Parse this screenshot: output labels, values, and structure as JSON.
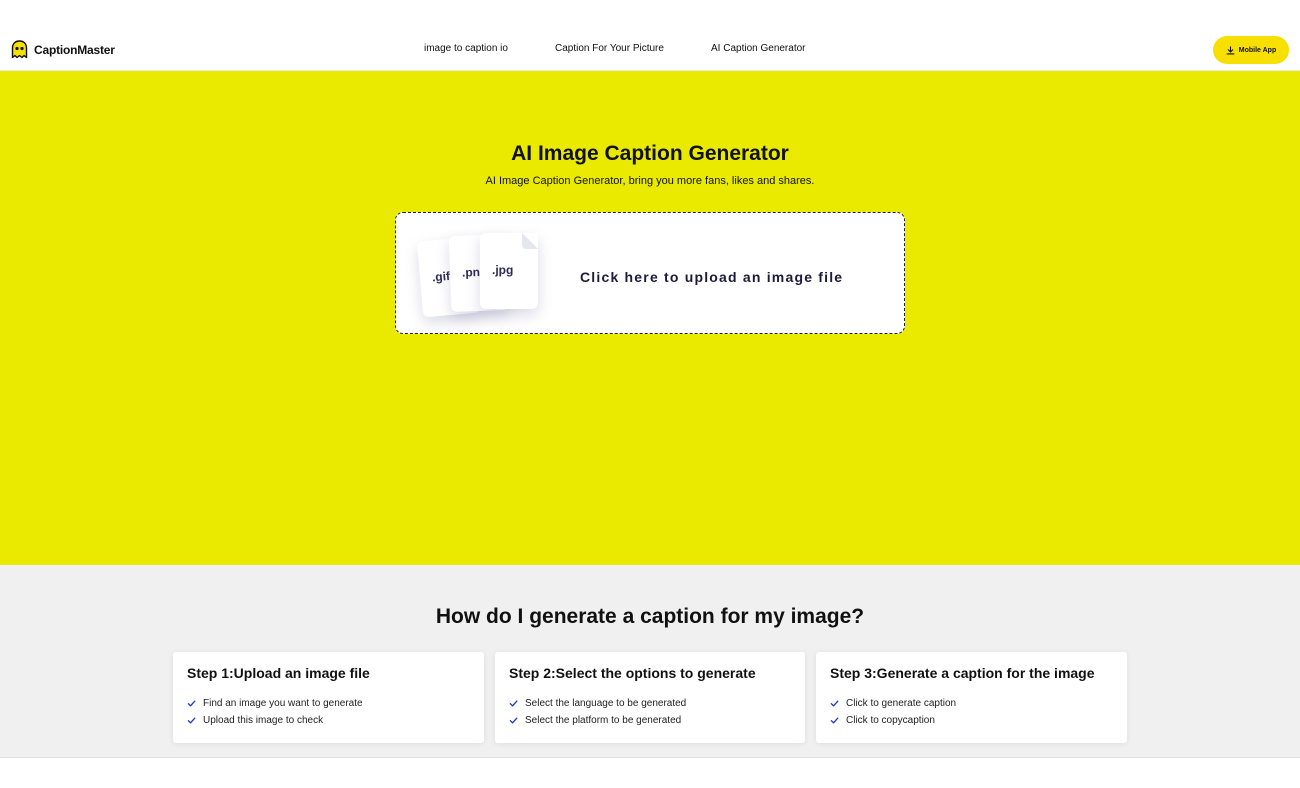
{
  "header": {
    "brand_name": "CaptionMaster",
    "nav": [
      "image to caption io",
      "Caption For Your Picture",
      "AI Caption Generator"
    ],
    "mobile_button_label": "Mobile App"
  },
  "hero": {
    "title": "AI Image Caption Generator",
    "subtitle": "AI Image Caption Generator, bring you more fans, likes and shares.",
    "upload": {
      "file_types": [
        ".gif",
        ".pn",
        ".jpg"
      ],
      "label": "Click here to upload an image file"
    }
  },
  "steps": {
    "title": "How do I generate a caption for my image?",
    "cards": [
      {
        "title": "Step 1:Upload an image file",
        "items": [
          "Find an image you want to generate",
          "Upload this image to check"
        ]
      },
      {
        "title": "Step 2:Select the options to generate",
        "items": [
          "Select the language to be generated",
          "Select the platform to be generated"
        ]
      },
      {
        "title": "Step 3:Generate a caption for the image",
        "items": [
          "Click to generate caption",
          "Click to copycaption"
        ]
      }
    ]
  },
  "colors": {
    "hero_bg": "#eae900",
    "button_bg": "#f7df00",
    "check_color": "#1d3fb8",
    "section_bg": "#f0f0f0"
  },
  "icons": {
    "logo": "ghost-logo-icon",
    "download": "download-icon",
    "check": "check-icon"
  }
}
